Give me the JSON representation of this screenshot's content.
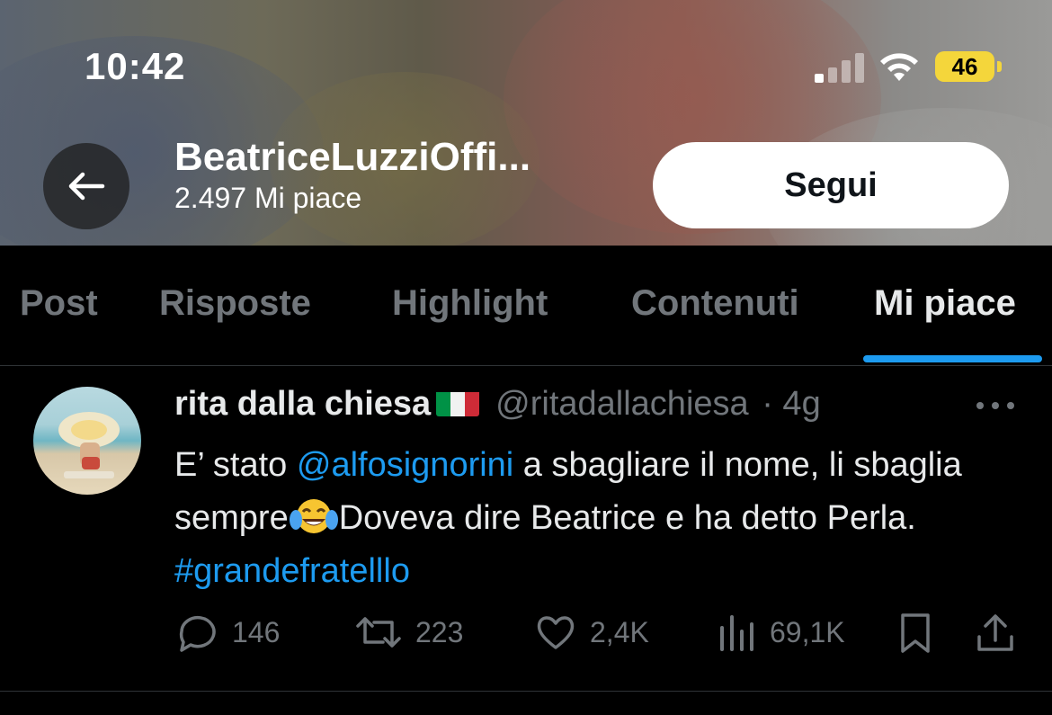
{
  "status_bar": {
    "time": "10:42",
    "battery": "46"
  },
  "profile": {
    "name": "BeatriceLuzziOffi...",
    "likes": "2.497 Mi piace",
    "follow_label": "Segui"
  },
  "tabs": [
    {
      "label": "Post"
    },
    {
      "label": "Risposte"
    },
    {
      "label": "Highlight"
    },
    {
      "label": "Contenuti"
    },
    {
      "label": "Mi piace"
    }
  ],
  "active_tab": "Mi piace",
  "tweet": {
    "author": "rita dalla chiesa",
    "handle": "@ritadallachiesa",
    "time": "· 4g",
    "text_part1": "E’ stato ",
    "mention": "@alfosignorini",
    "text_part2": " a sbagliare il nome, li sbaglia sempre",
    "text_part3": "Doveva dire Beatrice e ha detto Perla. ",
    "hashtag": "#grandefratelllo",
    "replies": "146",
    "retweets": "223",
    "likes": "2,4K",
    "views": "69,1K"
  },
  "colors": {
    "accent": "#1d9bf0",
    "muted": "#71767b",
    "battery": "#f4d63b"
  }
}
